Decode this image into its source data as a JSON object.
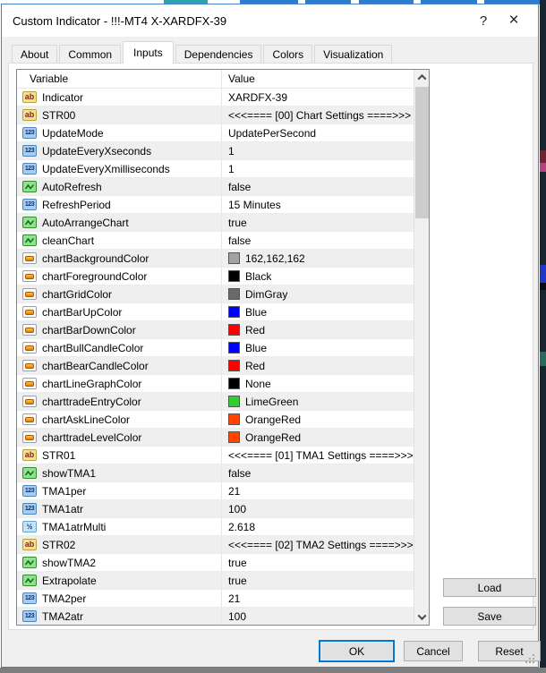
{
  "window": {
    "title": "Custom Indicator - !!!-MT4 X-XARDFX-39",
    "help_glyph": "?",
    "close_glyph": "×"
  },
  "tabs": [
    {
      "label": "About",
      "active": false
    },
    {
      "label": "Common",
      "active": false
    },
    {
      "label": "Inputs",
      "active": true
    },
    {
      "label": "Dependencies",
      "active": false
    },
    {
      "label": "Colors",
      "active": false
    },
    {
      "label": "Visualization",
      "active": false
    }
  ],
  "table": {
    "columns": [
      "Variable",
      "Value"
    ],
    "rows": [
      {
        "type": "ab",
        "variable": "Indicator",
        "value": "XARDFX-39"
      },
      {
        "type": "ab",
        "variable": "STR00",
        "value": "<<<==== [00] Chart Settings ====>>>"
      },
      {
        "type": "num",
        "variable": "UpdateMode",
        "value": "UpdatePerSecond"
      },
      {
        "type": "num",
        "variable": "UpdateEveryXseconds",
        "value": "1"
      },
      {
        "type": "num",
        "variable": "UpdateEveryXmilliseconds",
        "value": "1"
      },
      {
        "type": "bool",
        "variable": "AutoRefresh",
        "value": "false"
      },
      {
        "type": "num",
        "variable": "RefreshPeriod",
        "value": "15 Minutes"
      },
      {
        "type": "bool",
        "variable": "AutoArrangeChart",
        "value": "true"
      },
      {
        "type": "bool",
        "variable": "cleanChart",
        "value": "false"
      },
      {
        "type": "colr",
        "variable": "chartBackgroundColor",
        "value": "162,162,162",
        "swatch": "#a2a2a2"
      },
      {
        "type": "colr",
        "variable": "chartForegroundColor",
        "value": "Black",
        "swatch": "#000000"
      },
      {
        "type": "colr",
        "variable": "chartGridColor",
        "value": "DimGray",
        "swatch": "#696969"
      },
      {
        "type": "colr",
        "variable": "chartBarUpColor",
        "value": "Blue",
        "swatch": "#0000ff"
      },
      {
        "type": "colr",
        "variable": "chartBarDownColor",
        "value": "Red",
        "swatch": "#ff0000"
      },
      {
        "type": "colr",
        "variable": "chartBullCandleColor",
        "value": "Blue",
        "swatch": "#0000ff"
      },
      {
        "type": "colr",
        "variable": "chartBearCandleColor",
        "value": "Red",
        "swatch": "#ff0000"
      },
      {
        "type": "colr",
        "variable": "chartLineGraphColor",
        "value": "None",
        "swatch": "#000000"
      },
      {
        "type": "colr",
        "variable": "charttradeEntryColor",
        "value": "LimeGreen",
        "swatch": "#32cd32"
      },
      {
        "type": "colr",
        "variable": "chartAskLineColor",
        "value": "OrangeRed",
        "swatch": "#ff4500"
      },
      {
        "type": "colr",
        "variable": "charttradeLevelColor",
        "value": "OrangeRed",
        "swatch": "#ff4500"
      },
      {
        "type": "ab",
        "variable": "STR01",
        "value": "<<<==== [01] TMA1 Settings ====>>>"
      },
      {
        "type": "bool",
        "variable": "showTMA1",
        "value": "false"
      },
      {
        "type": "num",
        "variable": "TMA1per",
        "value": "21"
      },
      {
        "type": "num",
        "variable": "TMA1atr",
        "value": "100"
      },
      {
        "type": "dec",
        "variable": "TMA1atrMulti",
        "value": "2.618"
      },
      {
        "type": "ab",
        "variable": "STR02",
        "value": "<<<==== [02] TMA2 Settings ====>>>"
      },
      {
        "type": "bool",
        "variable": "showTMA2",
        "value": "true"
      },
      {
        "type": "bool",
        "variable": "Extrapolate",
        "value": "true"
      },
      {
        "type": "num",
        "variable": "TMA2per",
        "value": "21"
      },
      {
        "type": "num",
        "variable": "TMA2atr",
        "value": "100"
      }
    ]
  },
  "icons": {
    "ab": {
      "name": "string-ab-icon",
      "glyph": "ab"
    },
    "num": {
      "name": "integer-123-icon",
      "glyph": "123"
    },
    "dec": {
      "name": "decimal-half-icon",
      "glyph": "½"
    },
    "bool": {
      "name": "boolean-check-icon",
      "glyph": ""
    },
    "colr": {
      "name": "color-swatch-icon",
      "glyph": ""
    }
  },
  "side_buttons": [
    {
      "label": "Load"
    },
    {
      "label": "Save"
    }
  ],
  "footer_buttons": [
    {
      "label": "OK",
      "default": true
    },
    {
      "label": "Cancel",
      "default": false
    },
    {
      "label": "Reset",
      "default": false
    }
  ],
  "colors": {
    "window_border": "#4584c0",
    "default_button_border": "#0078d7",
    "alt_row": "#efefef",
    "scroll_thumb": "#cdcdcd"
  }
}
